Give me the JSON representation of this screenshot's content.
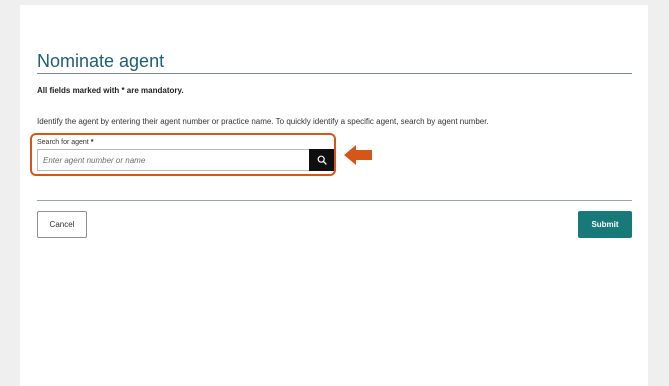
{
  "form": {
    "title": "Nominate agent",
    "mandatory_note": "All fields marked with * are mandatory.",
    "instructions": "Identify the agent by entering their agent number or practice name. To quickly identify a specific agent, search by agent number.",
    "search": {
      "label": "Search for agent",
      "required_marker": "*",
      "value": "",
      "placeholder": "Enter agent number or name",
      "button_icon": "search-icon"
    }
  },
  "annotation": {
    "highlight_color": "#d4571a",
    "arrow_icon": "left-arrow-icon"
  },
  "actions": {
    "cancel_label": "Cancel",
    "submit_label": "Submit",
    "submit_color": "#177a78"
  }
}
